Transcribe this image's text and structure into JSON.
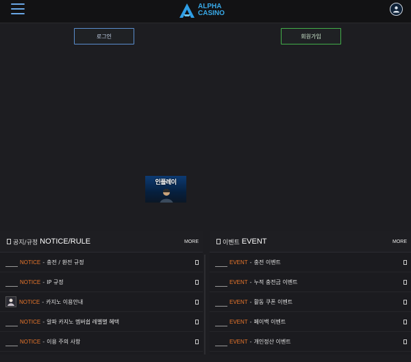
{
  "header": {
    "logo_line1": "ALPHA",
    "logo_line2": "CASINO",
    "menu_icon": "hamburger-icon",
    "user_icon": "user-icon",
    "accent": "#38a9e8"
  },
  "auth": {
    "login_label": "로그인",
    "join_label": "회원가입"
  },
  "banner": {
    "title": "인플레이"
  },
  "notice": {
    "title_ko": "공지/규정",
    "title_en": "NOTICE/RULE",
    "more": "MORE",
    "items": [
      {
        "tag": "NOTICE",
        "title": "충전 / 환전 규정"
      },
      {
        "tag": "NOTICE",
        "title": "IP 규정"
      },
      {
        "tag": "NOTICE",
        "title": "카지노 이용안내"
      },
      {
        "tag": "NOTICE",
        "title": "알파 카지노 멤버쉽 레벨별 혜택"
      },
      {
        "tag": "NOTICE",
        "title": "이용 주의 사항"
      }
    ]
  },
  "event": {
    "title_ko": "이벤트",
    "title_en": "EVENT",
    "more": "MORE",
    "items": [
      {
        "tag": "EVENT",
        "title": "충전 이벤트"
      },
      {
        "tag": "EVENT",
        "title": "누적 충전금 이벤트"
      },
      {
        "tag": "EVENT",
        "title": "활동 쿠폰 이벤트"
      },
      {
        "tag": "EVENT",
        "title": "페이백 이벤트"
      },
      {
        "tag": "EVENT",
        "title": "개인정산 이벤트"
      }
    ]
  },
  "colors": {
    "tag": "#e9762b",
    "login_border": "#5b8fd0",
    "join_border": "#43b04a"
  }
}
